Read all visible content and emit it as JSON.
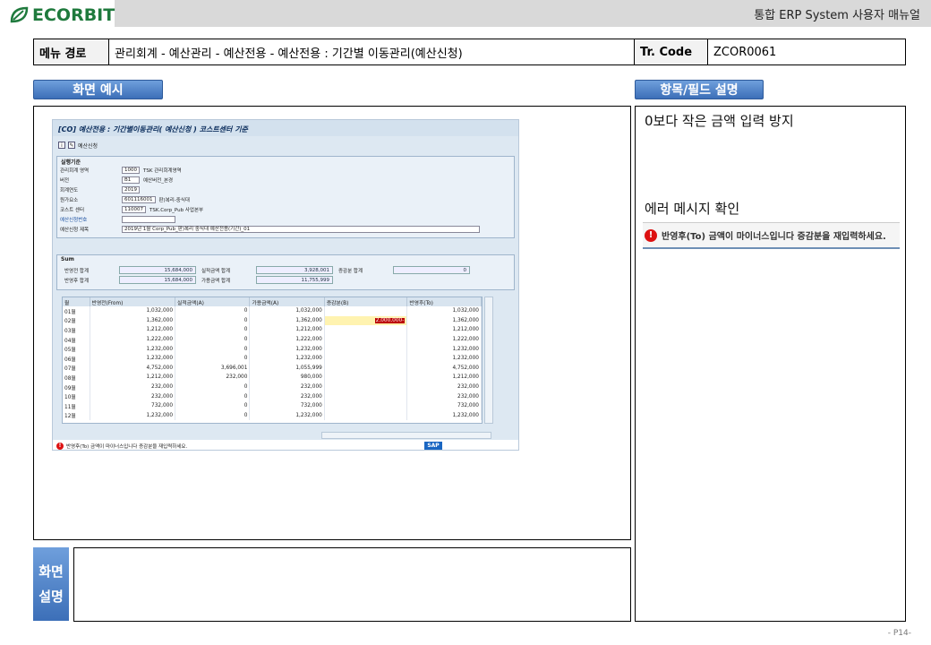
{
  "header": {
    "brand": "ECORBIT",
    "brand_color": "#1f7a3d",
    "doc_title": "통합 ERP System 사용자 매뉴얼"
  },
  "path_row": {
    "menu_label": "메뉴 경로",
    "menu_path": "관리회계 - 예산관리 - 예산전용 - 예산전용 : 기간별 이동관리(예산신청)",
    "tcode_label": "Tr. Code",
    "tcode_value": "ZCOR0061"
  },
  "tabs": {
    "example": "화면 예시",
    "fields": "항목/필드 설명"
  },
  "description_label": [
    "화면",
    "설명"
  ],
  "field_notes": {
    "note1": "0보다 작은 금액 입력 방지",
    "note2": "에러 메시지 확인",
    "error_message": "반영후(To) 금액이 마이너스입니다 증감분을 재입력하세요."
  },
  "sap": {
    "title": "[CO] 예산전용 : 기간별이동관리( 예산신청 ) 코스트센터 기준",
    "toolbar_label": "예산신청",
    "cond_group": "실행기준",
    "fields": [
      {
        "label": "관리회계 영역",
        "value": "1000",
        "desc": "TSK 관리회계영역"
      },
      {
        "label": "버전",
        "value": "B1",
        "desc": "예산버전_본경"
      },
      {
        "label": "회계연도",
        "value": "2019",
        "desc": ""
      },
      {
        "label": "원가요소",
        "value": "601116001",
        "desc": "판)복리-중식대"
      },
      {
        "label": "코스트 센터",
        "value": "110007",
        "desc": "TSK.Corp_Pub 사업본부"
      },
      {
        "label": "예산신청번호",
        "value": "",
        "desc": ""
      },
      {
        "label": "예산신청 제목",
        "value": "2019년 1월 Corp_Pub_판)복리 중식대 예산전용(기간)_01",
        "desc": ""
      }
    ],
    "sum_group": "Sum",
    "sums": {
      "before_label": "반영전 합계",
      "before": "15,684,000",
      "actual_label": "실적금액 합계",
      "actual": "3,928,001",
      "change_label": "증감분 합계",
      "change": "0",
      "after_label": "반영후 합계",
      "after": "15,684,000",
      "avail_label": "가용금액 합계",
      "avail": "11,755,999"
    },
    "columns": [
      "월",
      "반영전(From)",
      "실적금액(A)",
      "가용금액(A)",
      "증감분(B)",
      "반영후(To)"
    ],
    "rows": [
      [
        "01월",
        "1,032,000",
        "0",
        "1,032,000",
        "",
        "1,032,000"
      ],
      [
        "02월",
        "1,362,000",
        "0",
        "1,362,000",
        "2,000,000-",
        "1,362,000"
      ],
      [
        "03월",
        "1,212,000",
        "0",
        "1,212,000",
        "",
        "1,212,000"
      ],
      [
        "04월",
        "1,222,000",
        "0",
        "1,222,000",
        "",
        "1,222,000"
      ],
      [
        "05월",
        "1,232,000",
        "0",
        "1,232,000",
        "",
        "1,232,000"
      ],
      [
        "06월",
        "1,232,000",
        "0",
        "1,232,000",
        "",
        "1,232,000"
      ],
      [
        "07월",
        "4,752,000",
        "3,696,001",
        "1,055,999",
        "",
        "4,752,000"
      ],
      [
        "08월",
        "1,212,000",
        "232,000",
        "980,000",
        "",
        "1,212,000"
      ],
      [
        "09월",
        "232,000",
        "0",
        "232,000",
        "",
        "232,000"
      ],
      [
        "10월",
        "232,000",
        "0",
        "232,000",
        "",
        "232,000"
      ],
      [
        "11월",
        "732,000",
        "0",
        "732,000",
        "",
        "732,000"
      ],
      [
        "12월",
        "1,232,000",
        "0",
        "1,232,000",
        "",
        "1,232,000"
      ]
    ],
    "status": "반영후(To) 금액이 마이너스입니다 증감분을 재입력하세요.",
    "logo": "SAP"
  },
  "page_number": "- P14-"
}
